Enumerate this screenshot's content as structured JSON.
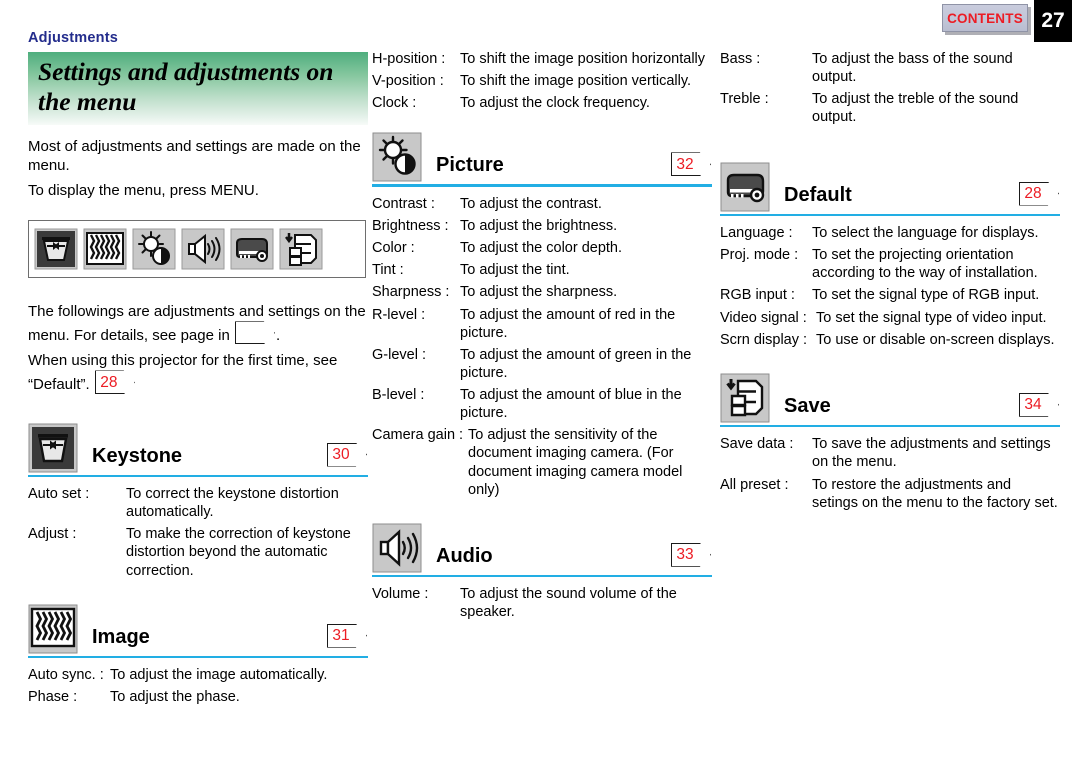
{
  "header": {
    "contents_label": "CONTENTS",
    "page_number": "27"
  },
  "left_column": {
    "kicker": "Adjustments",
    "title": "Settings and adjustments on the menu",
    "intro_line_1": "Most of adjustments and settings are made on the menu.",
    "intro_line_2": "To display the menu, press MENU.",
    "menu_icons": [
      "keystone-icon",
      "image-pattern-icon",
      "picture-brightness-icon",
      "audio-speaker-icon",
      "default-projector-icon",
      "save-stack-icon"
    ],
    "intro2_line_1_a": "The followings are adjustments and settings on the menu. For details, see page in",
    "intro2_line_1_b": ".",
    "intro2_line_2_a": "When using this projector for the first time, see “Default”.",
    "intro2_default_ref": "28",
    "sections": [
      {
        "icon": "keystone-icon",
        "title": "Keystone",
        "page_ref": "30",
        "items": [
          {
            "term": "Auto set :",
            "desc": "To correct the keystone distortion automatically."
          },
          {
            "term": "Adjust :",
            "desc": "To make the correction of keystone distortion beyond the automatic correction."
          }
        ]
      },
      {
        "icon": "image-pattern-icon",
        "title": "Image",
        "page_ref": "31",
        "items": [
          {
            "term": "Auto sync. :",
            "desc": "To adjust the image automatically."
          },
          {
            "term": "Phase :",
            "desc": "To adjust the phase."
          }
        ]
      }
    ]
  },
  "mid_column": {
    "continued_items": [
      {
        "term": "H-position :",
        "desc": "To shift the image position horizontally"
      },
      {
        "term": "V-position :",
        "desc": "To shift the image position vertically."
      },
      {
        "term": "Clock :",
        "desc": "To adjust the clock frequency."
      }
    ],
    "sections": [
      {
        "icon": "picture-brightness-icon",
        "title": "Picture",
        "page_ref": "32",
        "items": [
          {
            "term": "Contrast :",
            "desc": "To adjust the contrast."
          },
          {
            "term": "Brightness :",
            "desc": "To adjust the brightness."
          },
          {
            "term": "Color :",
            "desc": "To adjust the color depth."
          },
          {
            "term": "Tint :",
            "desc": "To adjust the tint."
          },
          {
            "term": "Sharpness :",
            "desc": "To adjust the sharpness."
          },
          {
            "term": "R-level :",
            "desc": "To adjust the amount of red in the picture."
          },
          {
            "term": "G-level :",
            "desc": "To adjust the amount of green in the picture."
          },
          {
            "term": "B-level :",
            "desc": "To adjust the amount of blue in the picture."
          },
          {
            "term": "Camera gain :",
            "desc": "To adjust the sensitivity of the document imaging camera. (For document imaging camera model only)"
          }
        ]
      },
      {
        "icon": "audio-speaker-icon",
        "title": "Audio",
        "page_ref": "33",
        "items": [
          {
            "term": "Volume :",
            "desc": "To adjust the sound volume of the speaker."
          }
        ]
      }
    ]
  },
  "right_column": {
    "continued_items": [
      {
        "term": "Bass :",
        "desc": "To adjust the bass of the sound output."
      },
      {
        "term": "Treble :",
        "desc": "To adjust the treble of the sound output."
      }
    ],
    "sections": [
      {
        "icon": "default-projector-icon",
        "title": "Default",
        "page_ref": "28",
        "items": [
          {
            "term": "Language :",
            "desc": "To select the language for displays."
          },
          {
            "term": "Proj. mode :",
            "desc": "To set the projecting orientation according to the way of installation."
          },
          {
            "term": "RGB input :",
            "desc": "To set the signal type of RGB input."
          },
          {
            "term": "Video signal :",
            "desc": "To set the signal type of video input."
          },
          {
            "term": "Scrn display :",
            "desc": "To use or disable on-screen displays."
          }
        ]
      },
      {
        "icon": "save-stack-icon",
        "title": "Save",
        "page_ref": "34",
        "items": [
          {
            "term": "Save data :",
            "desc": "To save the adjustments and settings on the menu."
          },
          {
            "term": "All preset :",
            "desc": "To restore the adjustments and setings on the menu to the factory set."
          }
        ]
      }
    ]
  },
  "colors": {
    "kicker": "#232c8c",
    "banner_green": "#4fae7e",
    "rule_blue": "#22aee4",
    "badge_red": "#ec1c24",
    "page_box": "#000000"
  }
}
